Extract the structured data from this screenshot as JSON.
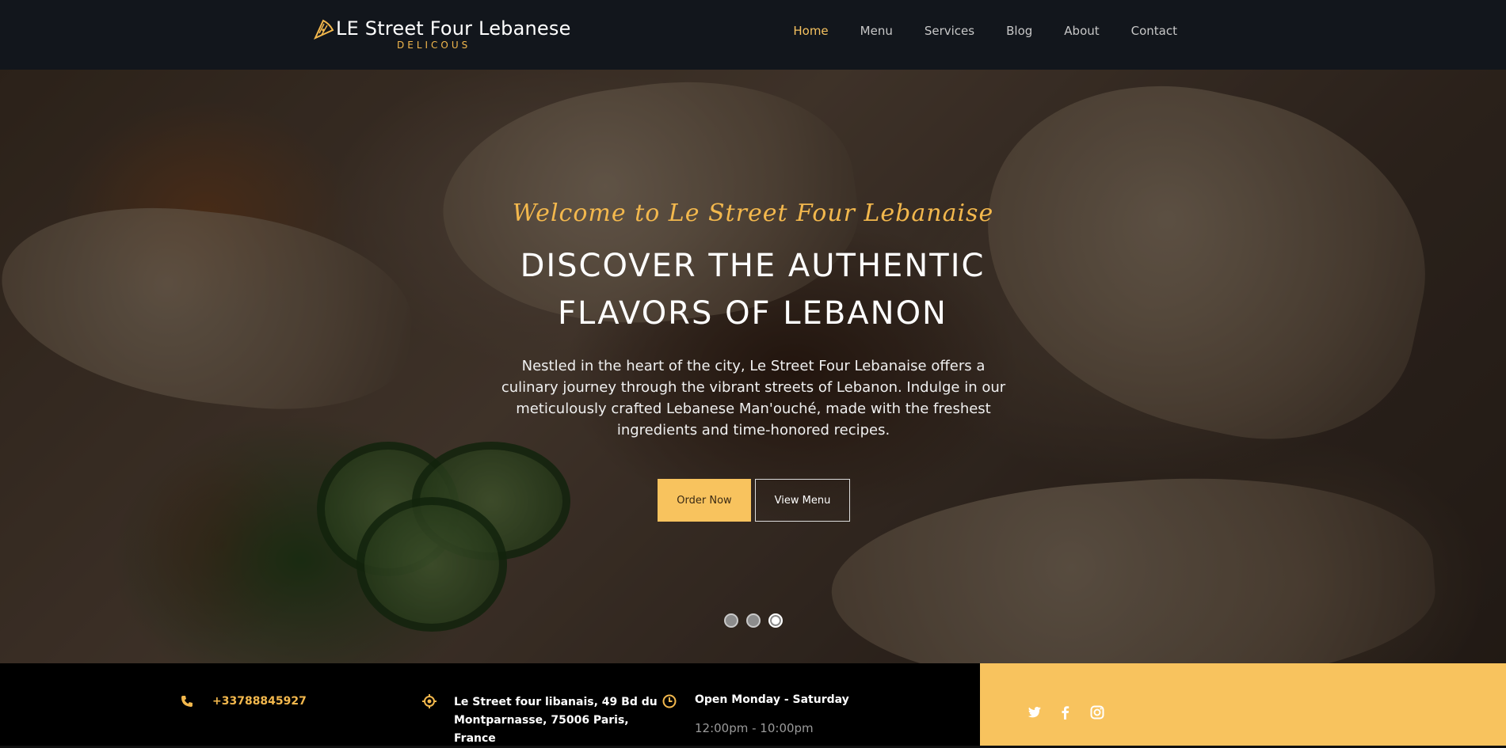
{
  "brand": {
    "title": "LE Street Four Lebanese",
    "subtitle": "DELICOUS"
  },
  "nav": {
    "items": [
      {
        "label": "Home",
        "active": true
      },
      {
        "label": "Menu",
        "active": false
      },
      {
        "label": "Services",
        "active": false
      },
      {
        "label": "Blog",
        "active": false
      },
      {
        "label": "About",
        "active": false
      },
      {
        "label": "Contact",
        "active": false
      }
    ]
  },
  "hero": {
    "welcome": "Welcome to Le Street Four Lebanaise",
    "headline_line1": "DISCOVER THE AUTHENTIC",
    "headline_line2": "FLAVORS OF LEBANON",
    "description": "Nestled in the heart of the city, Le Street Four Lebanaise offers a culinary journey through the vibrant streets of Lebanon. Indulge in our meticulously crafted Lebanese Man'ouché, made with the freshest ingredients and time-honored recipes.",
    "order_button": "Order Now",
    "menu_button": "View Menu",
    "slides_total": 3,
    "active_slide": 3
  },
  "info": {
    "phone": "+33788845927",
    "address": "Le Street four libanais, 49 Bd du Montparnasse, 75006 Paris, France",
    "open_days": "Open Monday - Saturday",
    "hours": "12:00pm - 10:00pm",
    "social": [
      "twitter-icon",
      "facebook-icon",
      "instagram-icon"
    ]
  },
  "colors": {
    "accent": "#f8c35e",
    "nav_bg": "#12161c",
    "info_bg": "#000000"
  }
}
